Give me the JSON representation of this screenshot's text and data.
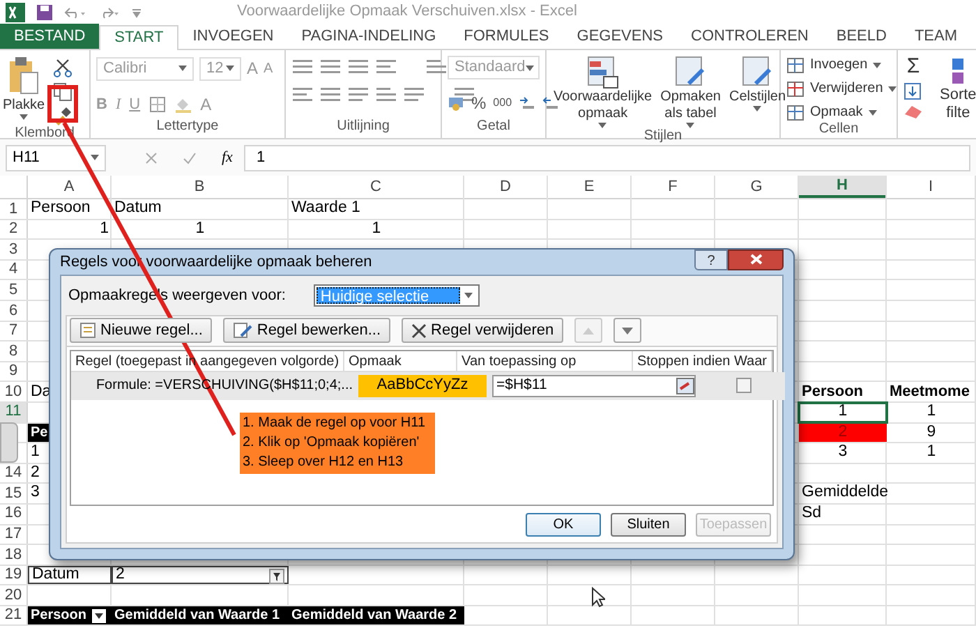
{
  "window": {
    "title": "Voorwaardelijke Opmaak Verschuiven.xlsx - Excel"
  },
  "tabs": [
    {
      "label": "BESTAND",
      "kind": "file",
      "selected": false
    },
    {
      "label": "START",
      "kind": "tab",
      "selected": true
    },
    {
      "label": "INVOEGEN",
      "kind": "tab",
      "selected": false
    },
    {
      "label": "PAGINA-INDELING",
      "kind": "tab",
      "selected": false
    },
    {
      "label": "FORMULES",
      "kind": "tab",
      "selected": false
    },
    {
      "label": "GEGEVENS",
      "kind": "tab",
      "selected": false
    },
    {
      "label": "CONTROLEREN",
      "kind": "tab",
      "selected": false
    },
    {
      "label": "BEELD",
      "kind": "tab",
      "selected": false
    },
    {
      "label": "TEAM",
      "kind": "tab",
      "selected": false
    }
  ],
  "ribbon": {
    "groups": [
      {
        "kind": "clipboard",
        "label": "Klembord",
        "paste": "Plakke"
      },
      {
        "kind": "font",
        "label": "Lettertype",
        "font": "Calibri",
        "size": "12",
        "grow": "A",
        "shrink": "A",
        "styles": [
          "B",
          "I",
          "U"
        ],
        "font_color": "A"
      },
      {
        "kind": "alignment",
        "label": "Uitlijning"
      },
      {
        "kind": "number",
        "label": "Getal",
        "format": "Standaard",
        "percent": "%",
        "thousands": "000"
      },
      {
        "kind": "styles",
        "label": "Stijlen",
        "buttons": [
          {
            "lines": [
              "Voorwaardelijke",
              "opmaak"
            ]
          },
          {
            "lines": [
              "Opmaken",
              "als tabel"
            ]
          },
          {
            "lines": [
              "Celstijlen"
            ]
          }
        ]
      },
      {
        "kind": "cells",
        "label": "Cellen",
        "buttons": [
          "Invoegen",
          "Verwijderen",
          "Opmaak"
        ]
      },
      {
        "kind": "editing",
        "sum": "Σ",
        "sort": [
          "Sorte",
          "filte"
        ]
      }
    ]
  },
  "formula_bar": {
    "name_box": "H11",
    "function_label": "fx",
    "value": "1"
  },
  "grid": {
    "columns": [
      {
        "label": "A",
        "selected": false
      },
      {
        "label": "B",
        "selected": false
      },
      {
        "label": "C",
        "selected": false
      },
      {
        "label": "D",
        "selected": false
      },
      {
        "label": "E",
        "selected": false
      },
      {
        "label": "F",
        "selected": false
      },
      {
        "label": "G",
        "selected": false
      },
      {
        "label": "H",
        "selected": true
      },
      {
        "label": "I",
        "selected": false
      }
    ],
    "rows": [
      {
        "number": "1",
        "selected": false,
        "cells": [
          {
            "text": "Persoon",
            "kind": "text"
          },
          {
            "text": "Datum",
            "kind": "text"
          },
          {
            "text": "Waarde 1",
            "kind": "text"
          }
        ]
      },
      {
        "number": "2",
        "selected": false,
        "cells": [
          {
            "text": "1",
            "kind": "value"
          },
          {
            "text": "1",
            "kind": "number"
          },
          {
            "text": "1",
            "kind": "number"
          }
        ]
      },
      {
        "number": "3",
        "selected": false,
        "cells": []
      },
      {
        "number": "4",
        "selected": false,
        "cells": []
      },
      {
        "number": "5",
        "selected": false,
        "cells": []
      },
      {
        "number": "6",
        "selected": false,
        "cells": []
      },
      {
        "number": "7",
        "selected": false,
        "cells": []
      },
      {
        "number": "8",
        "selected": false,
        "cells": []
      },
      {
        "number": "9",
        "selected": false,
        "cells": []
      },
      {
        "number": "10",
        "selected": false,
        "cells": [
          {
            "text": "Da",
            "kind": "text"
          },
          null,
          null,
          null,
          null,
          null,
          null,
          {
            "text": "Persoon",
            "kind": "heading"
          },
          {
            "text": "Meetmome",
            "kind": "heading"
          }
        ]
      },
      {
        "number": "11",
        "selected": true,
        "cells": [
          null,
          null,
          null,
          null,
          null,
          null,
          null,
          {
            "text": "1",
            "kind": "number"
          },
          {
            "text": "1",
            "kind": "number"
          }
        ]
      },
      {
        "selected": false,
        "cells": [
          {
            "text": "Pe",
            "kind": "dark"
          },
          null,
          null,
          null,
          null,
          null,
          null,
          {
            "text": "2",
            "kind": "flagged"
          },
          {
            "text": "9",
            "kind": "number"
          }
        ]
      },
      {
        "selected": false,
        "cells": [
          {
            "text": "1",
            "kind": "text"
          },
          null,
          null,
          null,
          null,
          null,
          null,
          {
            "text": "3",
            "kind": "number"
          },
          {
            "text": "1",
            "kind": "number"
          }
        ]
      },
      {
        "number": "14",
        "selected": false,
        "cells": [
          {
            "text": "2",
            "kind": "text"
          }
        ]
      },
      {
        "number": "15",
        "selected": false,
        "cells": [
          {
            "text": "3",
            "kind": "text"
          },
          null,
          null,
          null,
          null,
          null,
          null,
          {
            "text": "Gemiddelde",
            "kind": "text"
          }
        ]
      },
      {
        "number": "16",
        "selected": false,
        "cells": [
          null,
          null,
          null,
          null,
          null,
          null,
          null,
          {
            "text": "Sd",
            "kind": "text"
          }
        ]
      },
      {
        "number": "17",
        "selected": false,
        "cells": []
      },
      {
        "number": "18",
        "selected": false,
        "cells": []
      },
      {
        "number": "19",
        "selected": false,
        "cells": [
          {
            "text": "Datum",
            "kind": "boxed"
          },
          {
            "text": "2",
            "kind": "filter"
          }
        ]
      },
      {
        "number": "20",
        "selected": false,
        "cells": []
      },
      {
        "number": "21",
        "selected": false,
        "cells": [
          {
            "text": "Persoon",
            "kind": "dark-dropdown"
          },
          {
            "text": "Gemiddeld van Waarde 1",
            "kind": "dark"
          },
          {
            "text": "Gemiddeld van Waarde 2",
            "kind": "dark"
          }
        ]
      }
    ]
  },
  "dialog": {
    "title": "Regels voor voorwaardelijke opmaak beheren",
    "help": "?",
    "scope_label": "Opmaakregels weergeven voor:",
    "scope_value": "Huidige selectie",
    "toolbar": [
      {
        "label": "Nieuwe regel...",
        "kind": "new"
      },
      {
        "label": "Regel bewerken...",
        "kind": "edit"
      },
      {
        "label": "Regel verwijderen",
        "kind": "delete"
      }
    ],
    "move_buttons": [
      {
        "kind": "up",
        "disabled": true
      },
      {
        "kind": "down",
        "disabled": false
      }
    ],
    "columns": [
      "Regel (toegepast in aangegeven volgorde)",
      "Opmaak",
      "Van toepassing op",
      "Stoppen indien Waar"
    ],
    "rules": [
      {
        "formula": "Formule: =VERSCHUIVING($H$11;0;4;...",
        "preview": "AaBbCcYyZz",
        "applies_to": "=$H$11",
        "stop": false,
        "selected": true
      }
    ],
    "buttons": [
      {
        "label": "OK",
        "kind": "default",
        "disabled": false
      },
      {
        "label": "Sluiten",
        "kind": "normal",
        "disabled": false
      },
      {
        "label": "Toepassen",
        "kind": "normal",
        "disabled": true
      }
    ]
  },
  "annotation": {
    "lines": [
      "1. Maak de regel op voor H11",
      "2. Klik op 'Opmaak kopiëren'",
      "3. Sleep over H12 en H13"
    ]
  }
}
